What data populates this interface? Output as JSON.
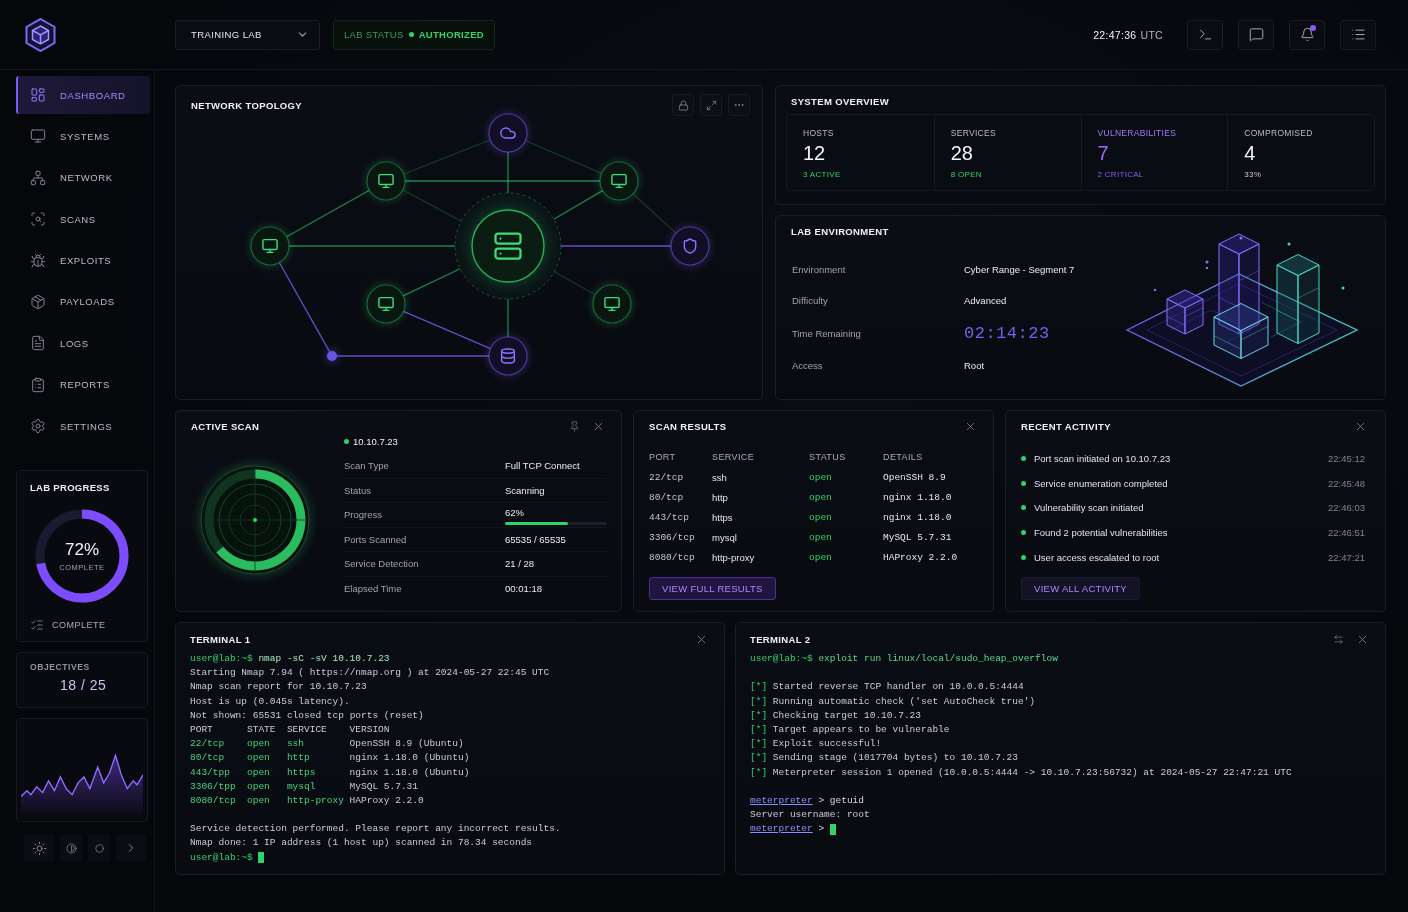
{
  "header": {
    "lab_select": {
      "value": "TRAINING LAB"
    },
    "status": {
      "label": "LAB STATUS",
      "value": "AUTHORIZED",
      "ok": true
    },
    "clock": {
      "time": "22:47:36",
      "zone": "UTC"
    },
    "notifications": {
      "unread": true
    }
  },
  "sidebar": {
    "items": [
      {
        "label": "DASHBOARD",
        "selected": true
      },
      {
        "label": "SYSTEMS",
        "selected": false
      },
      {
        "label": "NETWORK",
        "selected": false
      },
      {
        "label": "SCANS",
        "selected": false
      },
      {
        "label": "EXPLOITS",
        "selected": false
      },
      {
        "label": "PAYLOADS",
        "selected": false
      },
      {
        "label": "LOGS",
        "selected": false
      },
      {
        "label": "REPORTS",
        "selected": false
      },
      {
        "label": "SETTINGS",
        "selected": false
      }
    ],
    "progress": {
      "title": "LAB PROGRESS",
      "percent": "72%",
      "caption": "COMPLETE",
      "level": 0.72,
      "footer": "COMPLETE"
    },
    "objectives": {
      "title": "OBJECTIVES",
      "value": "18 / 25"
    }
  },
  "topology": {
    "title": "NETWORK TOPOLOGY"
  },
  "overview": {
    "title": "SYSTEM OVERVIEW",
    "stats": [
      {
        "kind": "ok",
        "label": "HOSTS",
        "value": "12",
        "note": "3 ACTIVE"
      },
      {
        "kind": "ok",
        "label": "SERVICES",
        "value": "28",
        "note": "8 OPEN"
      },
      {
        "kind": "alert",
        "label": "VULNERABILITIES",
        "value": "7",
        "note": "2 CRITICAL"
      },
      {
        "kind": "neutral",
        "label": "COMPROMISED",
        "value": "4",
        "note": "33%"
      }
    ]
  },
  "lab_environment": {
    "title": "LAB ENVIRONMENT",
    "rows": [
      {
        "kind": "text",
        "label": "Environment",
        "value": "Cyber Range - Segment 7"
      },
      {
        "kind": "text",
        "label": "Difficulty",
        "value": "Advanced"
      },
      {
        "kind": "timer",
        "label": "Time Remaining",
        "value": "02:14:23"
      },
      {
        "kind": "text",
        "label": "Access",
        "value": "Root"
      }
    ]
  },
  "active_scan": {
    "title": "ACTIVE SCAN",
    "target": "10.10.7.23",
    "online": true,
    "rows": [
      {
        "kind": "text",
        "label": "Scan Type",
        "value": "Full TCP Connect"
      },
      {
        "kind": "text",
        "label": "Status",
        "value": "Scanning"
      },
      {
        "kind": "progress",
        "label": "Progress",
        "value": "62%",
        "level": 0.62
      },
      {
        "kind": "text",
        "label": "Ports Scanned",
        "value": "65535 / 65535"
      },
      {
        "kind": "text",
        "label": "Service Detection",
        "value": "21 / 28"
      },
      {
        "kind": "text",
        "label": "Elapsed Time",
        "value": "00:01:18"
      }
    ]
  },
  "scan_results": {
    "title": "SCAN RESULTS",
    "columns": [
      "PORT",
      "SERVICE",
      "STATUS",
      "DETAILS"
    ],
    "rows": [
      {
        "port": "22/tcp",
        "service": "ssh",
        "status": "open",
        "details": "OpenSSH 8.9"
      },
      {
        "port": "80/tcp",
        "service": "http",
        "status": "open",
        "details": "nginx 1.18.0"
      },
      {
        "port": "443/tcp",
        "service": "https",
        "status": "open",
        "details": "nginx 1.18.0"
      },
      {
        "port": "3306/tcp",
        "service": "mysql",
        "status": "open",
        "details": "MySQL 5.7.31"
      },
      {
        "port": "8080/tcp",
        "service": "http-proxy",
        "status": "open",
        "details": "HAProxy 2.2.0"
      }
    ],
    "button": "VIEW FULL RESULTS"
  },
  "recent_activity": {
    "title": "RECENT ACTIVITY",
    "items": [
      {
        "text": "Port scan initiated on 10.10.7.23",
        "time": "22:45:12"
      },
      {
        "text": "Service enumeration completed",
        "time": "22:45:48"
      },
      {
        "text": "Vulnerability scan initiated",
        "time": "22:46:03"
      },
      {
        "text": "Found 2 potential vulnerabilities",
        "time": "22:46:51"
      },
      {
        "text": "User access escalated to root",
        "time": "22:47:21"
      }
    ],
    "button": "VIEW ALL ACTIVITY"
  },
  "terminals": [
    {
      "title": "TERMINAL 1",
      "lines": [
        {
          "kind": "prompt",
          "prompt": "user@lab:~$",
          "command": "nmap -sC -sV 10.10.7.23",
          "cursor": false
        },
        {
          "kind": "out",
          "text": "Starting Nmap 7.94 ( https://nmap.org ) at 2024-05-27 22:45 UTC"
        },
        {
          "kind": "out",
          "text": "Nmap scan report for 10.10.7.23"
        },
        {
          "kind": "out",
          "text": "Host is up (0.045s latency)."
        },
        {
          "kind": "out",
          "text": "Not shown: 65531 closed tcp ports (reset)"
        },
        {
          "kind": "head",
          "cells": [
            "PORT",
            "STATE",
            "SERVICE",
            "VERSION"
          ]
        },
        {
          "kind": "row",
          "cells": [
            "22/tcp",
            "open",
            "ssh",
            "OpenSSH 8.9 (Ubuntu)"
          ]
        },
        {
          "kind": "row",
          "cells": [
            "80/tcp",
            "open",
            "http",
            "nginx 1.18.0 (Ubuntu)"
          ]
        },
        {
          "kind": "row",
          "cells": [
            "443/tpp",
            "open",
            "https",
            "nginx 1.18.0 (Ubuntu)"
          ]
        },
        {
          "kind": "row",
          "cells": [
            "3306/tpp",
            "open",
            "mysql",
            "MySQL 5.7.31"
          ]
        },
        {
          "kind": "row",
          "cells": [
            "8080/tcp",
            "open",
            "http-proxy",
            "HAProxy 2.2.0"
          ]
        },
        {
          "kind": "blank"
        },
        {
          "kind": "out",
          "text": "Service detection performed. Please report any incorrect results."
        },
        {
          "kind": "out",
          "text": "Nmap done: 1 IP address (1 host up) scanned in 78.34 seconds"
        },
        {
          "kind": "prompt",
          "prompt": "user@lab:~$",
          "cursor": true
        }
      ]
    },
    {
      "title": "TERMINAL 2",
      "lines": [
        {
          "kind": "prompt",
          "prompt": "user@lab:~$",
          "command": "exploit run linux/local/sudo_heap_overflow",
          "cursor": false
        },
        {
          "kind": "blank"
        },
        {
          "kind": "info",
          "tag": "[*]",
          "text": "Started reverse TCP handler on 10.0.0.5:4444"
        },
        {
          "kind": "info",
          "tag": "[*]",
          "text": "Running automatic check ('set AutoCheck true')"
        },
        {
          "kind": "info",
          "tag": "[*]",
          "text": "Checking target 10.10.7.23"
        },
        {
          "kind": "info",
          "tag": "[*]",
          "text": "Target appears to be vulnerable"
        },
        {
          "kind": "info",
          "tag": "[*]",
          "text": "Exploit successful!"
        },
        {
          "kind": "info",
          "tag": "[*]",
          "text": "Sending stage (1017704 bytes) to 10.10.7.23"
        },
        {
          "kind": "info",
          "tag": "[*]",
          "text": "Meterpreter session 1 opened (10.0.0.5:4444 -> 10.10.7.23:56732) at 2024-05-27 22:47:21 UTC"
        },
        {
          "kind": "blank"
        },
        {
          "kind": "meter",
          "prompt": "meterpreter",
          "command": "> getuid",
          "cursor": false
        },
        {
          "kind": "out",
          "text": "Server username: root"
        },
        {
          "kind": "meter",
          "prompt": "meterpreter",
          "command": ">",
          "cursor": true
        }
      ]
    }
  ]
}
